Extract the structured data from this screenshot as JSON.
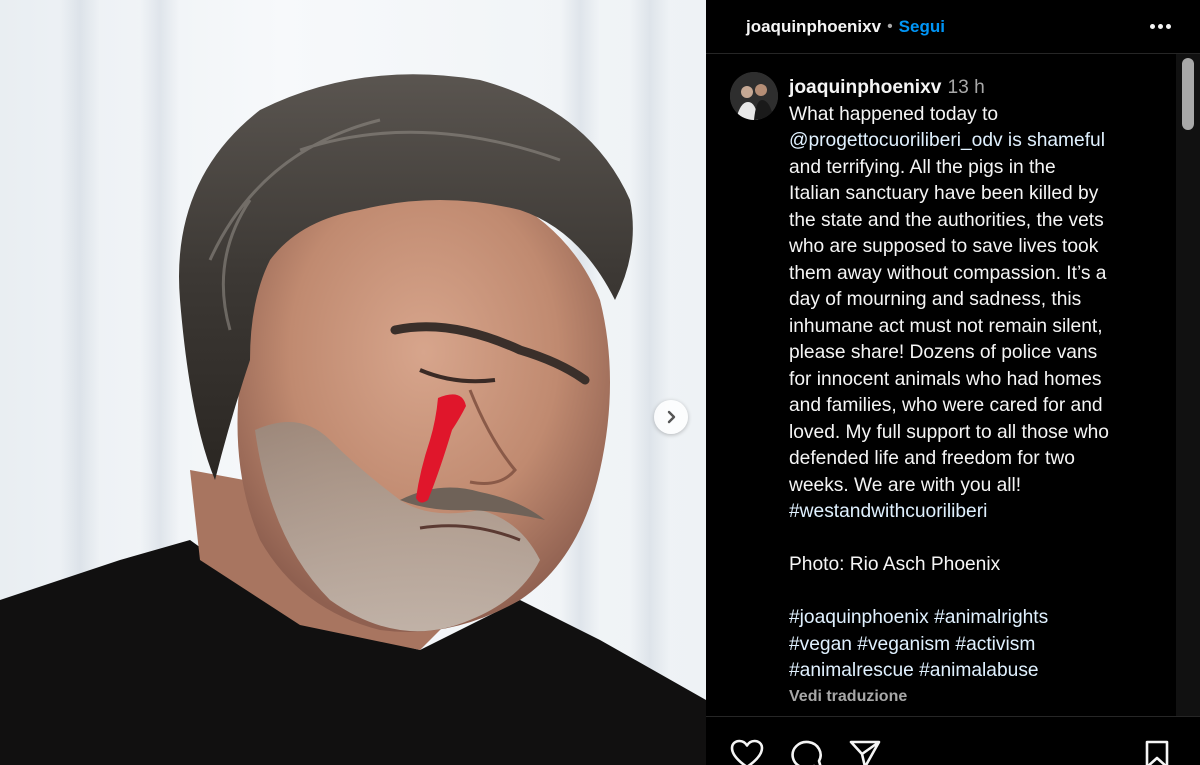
{
  "header": {
    "username": "joaquinphoenixv",
    "separator": "•",
    "follow_label": "Segui",
    "more_icon": "more-horizontal-icon"
  },
  "post": {
    "username": "joaquinphoenixv",
    "time": "13 h",
    "caption_lines": [
      "What happened today to",
      "@progettocuoriliberi_odv is shameful",
      "and terrifying. All the pigs in the",
      "Italian sanctuary have been killed by",
      "the state and the authorities, the vets",
      "who are supposed to save lives took",
      "them away without compassion. It’s a",
      "day of mourning and sadness, this",
      "inhumane act must not remain silent,",
      "please share! Dozens of police vans",
      "for innocent animals who had homes",
      "and families, who were cared for and",
      "loved. My full support to all those who",
      "defended life and freedom for two",
      "weeks. We are with you all!"
    ],
    "hashtag_line": "#westandwithcuoriliberi",
    "photo_credit": "Photo: Rio Asch Phoenix",
    "hashtags_lines": [
      "#joaquinphoenix #animalrights",
      "#vegan #veganism #activism",
      "#animalrescue #animalabuse"
    ],
    "see_translation": "Vedi traduzione"
  },
  "media": {
    "next_icon": "chevron-right-icon"
  },
  "actions": {
    "like_icon": "heart-icon",
    "comment_icon": "comment-icon",
    "share_icon": "send-icon",
    "save_icon": "bookmark-icon"
  },
  "colors": {
    "background": "#000000",
    "text": "#f5f5f5",
    "secondary": "#a8a8a8",
    "link": "#e0f1ff",
    "follow": "#0095f6",
    "divider": "#262626"
  }
}
